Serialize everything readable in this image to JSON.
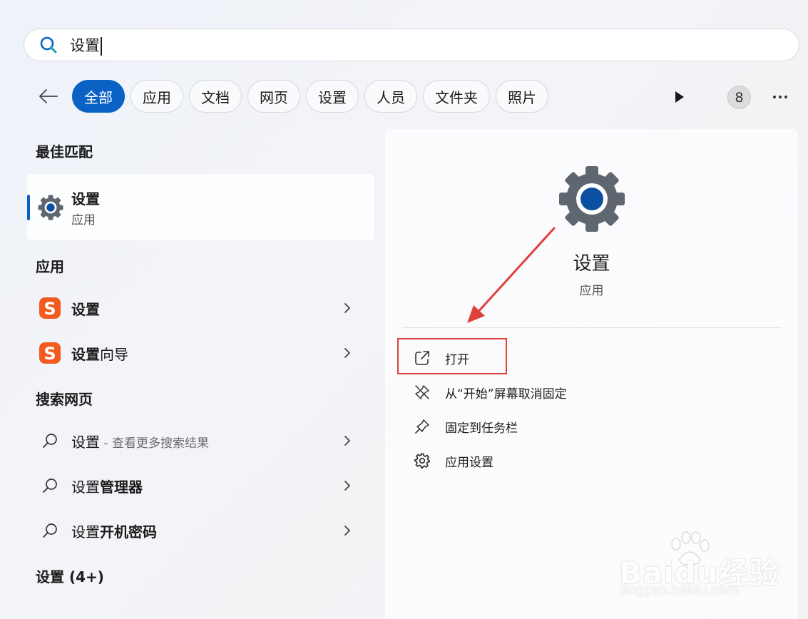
{
  "search": {
    "query": "设置"
  },
  "filters": [
    "全部",
    "应用",
    "文档",
    "网页",
    "设置",
    "人员",
    "文件夹",
    "照片"
  ],
  "filter_count": "8",
  "best_match": {
    "section": "最佳匹配",
    "title": "设置",
    "subtitle": "应用"
  },
  "apps": {
    "section": "应用",
    "items": [
      {
        "bold": "设置",
        "rest": ""
      },
      {
        "bold": "设置",
        "rest": "向导"
      }
    ]
  },
  "web": {
    "section": "搜索网页",
    "items": [
      {
        "bold": "",
        "normal": "设置",
        "hint": " - 查看更多搜索结果"
      },
      {
        "bold": "管理器",
        "normal": "设置",
        "hint": ""
      },
      {
        "bold": "开机密码",
        "normal": "设置",
        "hint": ""
      }
    ]
  },
  "settings_section": "设置 (4+)",
  "detail": {
    "title": "设置",
    "subtitle": "应用",
    "actions": [
      "打开",
      "从“开始”屏幕取消固定",
      "固定到任务栏",
      "应用设置"
    ]
  },
  "watermark": {
    "main": "Baidu经验",
    "sub": "jingyan.baidu.com"
  },
  "colors": {
    "accent": "#0a63c4",
    "annotation": "#e0403c"
  },
  "icons": [
    "search-icon",
    "back-arrow-icon",
    "play-icon",
    "more-icon",
    "settings-gear-icon",
    "sogou-icon",
    "chevron-right-icon",
    "web-search-icon",
    "open-external-icon",
    "unpin-icon",
    "pin-icon",
    "app-settings-icon"
  ]
}
